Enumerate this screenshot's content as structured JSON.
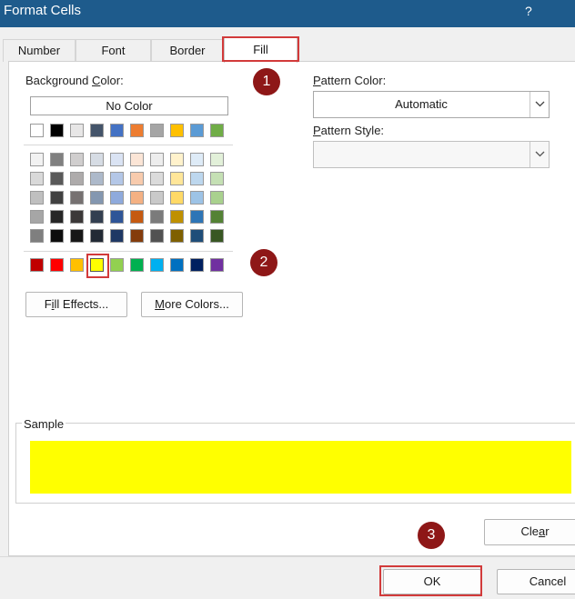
{
  "window": {
    "title": "Format Cells",
    "help": "?"
  },
  "tabs": [
    {
      "label": "Number",
      "active": false
    },
    {
      "label": "Font",
      "active": false
    },
    {
      "label": "Border",
      "active": false
    },
    {
      "label": "Fill",
      "active": true
    }
  ],
  "fill": {
    "background_color": {
      "label_before": "Background ",
      "label_key": "C",
      "label_after": "olor:"
    },
    "no_color_label": "No Color",
    "theme_row": [
      "#ffffff",
      "#000000",
      "#e7e6e6",
      "#44546a",
      "#4472c4",
      "#ed7d31",
      "#a5a5a5",
      "#ffc000",
      "#5b9bd5",
      "#70ad47"
    ],
    "shade_rows": [
      [
        "#f2f2f2",
        "#808080",
        "#d0cece",
        "#d6dce4",
        "#dae3f3",
        "#fbe5d6",
        "#ededed",
        "#fff2cc",
        "#deebf7",
        "#e2f0d9"
      ],
      [
        "#d9d9d9",
        "#595959",
        "#aeabab",
        "#adb9ca",
        "#b4c7e7",
        "#f8cbad",
        "#dbdbdb",
        "#ffe699",
        "#bdd7ee",
        "#c5e0b4"
      ],
      [
        "#bfbfbf",
        "#404040",
        "#767171",
        "#8497b0",
        "#8faadc",
        "#f4b183",
        "#c9c9c9",
        "#ffd966",
        "#9dc3e6",
        "#a9d18e"
      ],
      [
        "#a6a6a6",
        "#262626",
        "#3b3838",
        "#333f50",
        "#2f5597",
        "#c55a11",
        "#7b7b7b",
        "#bf9000",
        "#2e75b6",
        "#548235"
      ],
      [
        "#7f7f7f",
        "#0d0d0d",
        "#171717",
        "#222a35",
        "#1f3864",
        "#843c0c",
        "#525252",
        "#7f6000",
        "#1f4e79",
        "#385723"
      ]
    ],
    "standard_row": [
      "#c00000",
      "#ff0000",
      "#ffc000",
      "#ffff00",
      "#92d050",
      "#00b050",
      "#00b0f0",
      "#0070c0",
      "#002060",
      "#7030a0"
    ],
    "selected_standard_index": 3,
    "fill_effects": {
      "key": "i",
      "before": "F",
      "after": "ll Effects..."
    },
    "more_colors": {
      "key": "M",
      "before": "",
      "after": "ore Colors..."
    },
    "pattern_color": {
      "label_key": "P",
      "label_after": "attern Color:",
      "value": "Automatic"
    },
    "pattern_style": {
      "label_key": "P",
      "label_after": "attern Style:",
      "value": ""
    }
  },
  "sample": {
    "label": "Sample",
    "color": "#ffff00"
  },
  "buttons": {
    "clear": {
      "before": "Cle",
      "key": "a",
      "after": "r"
    },
    "ok": "OK",
    "cancel": "Cancel"
  },
  "markers": [
    "1",
    "2",
    "3"
  ],
  "colors": {
    "titlebar": "#1e5b8c",
    "highlight": "#d23a3a",
    "marker": "#8e1717"
  }
}
